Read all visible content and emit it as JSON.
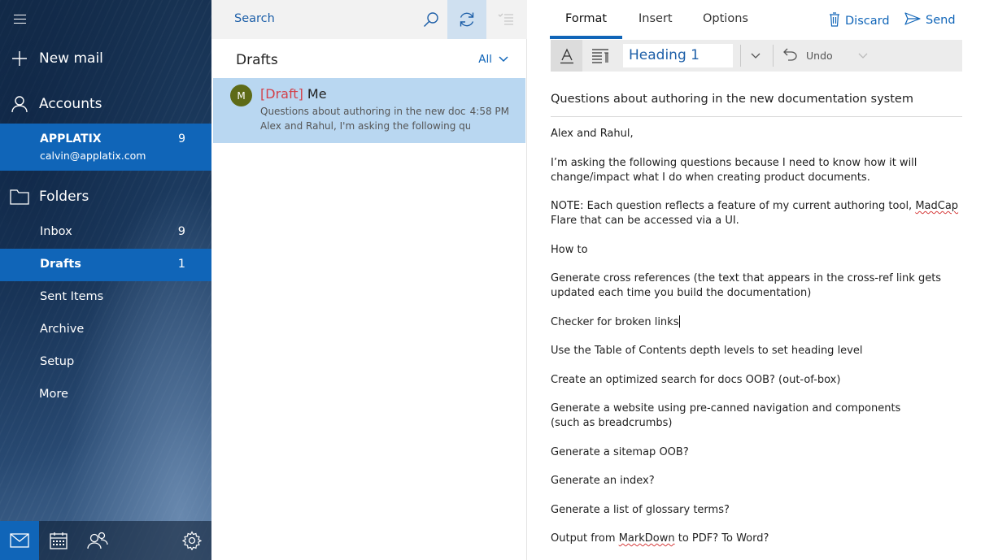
{
  "nav": {
    "new_mail": "New mail",
    "accounts": "Accounts",
    "account": {
      "name": "APPLATIX",
      "email": "calvin@applatix.com",
      "count": "9"
    },
    "folders_label": "Folders",
    "folders": [
      {
        "label": "Inbox",
        "count": "9"
      },
      {
        "label": "Drafts",
        "count": "1"
      },
      {
        "label": "Sent Items",
        "count": ""
      },
      {
        "label": "Archive",
        "count": ""
      },
      {
        "label": "Setup",
        "count": ""
      }
    ],
    "more": "More"
  },
  "list": {
    "search_placeholder": "Search",
    "folder_title": "Drafts",
    "filter": "All",
    "message": {
      "avatar": "M",
      "tag": "[Draft]",
      "from": "Me",
      "subject": "Questions about authoring in the new documentation system",
      "time": "4:58 PM",
      "preview": "Alex and Rahul,    I'm asking the following questions because I need to know"
    }
  },
  "compose": {
    "tabs": [
      "Format",
      "Insert",
      "Options"
    ],
    "discard": "Discard",
    "send": "Send",
    "style": "Heading 1",
    "undo": "Undo",
    "subject": "Questions about authoring in the new documentation system",
    "body": {
      "p1": "Alex and Rahul,",
      "p2": "I’m asking the following questions because I need to know how it will change/impact what I do when creating product documents.",
      "p3a": "NOTE: Each question reflects a feature of my current authoring tool, ",
      "p3b": "MadCap",
      "p3c": " Flare that can be accessed via a UI.",
      "p4": "How to",
      "p5": "Generate cross references (the text that appears in the cross-ref link gets updated each time you build the documentation)",
      "p6": "Checker for broken links",
      "p7": "Use the Table of Contents depth levels to set heading level",
      "p8": "Create an optimized search for docs OOB? (out-of-box)",
      "p9": "Generate a website using pre-canned navigation and components (such as breadcrumbs)",
      "p10": "Generate a sitemap OOB?",
      "p11": "Generate an index?",
      "p12": "Generate a list of glossary terms?",
      "p13a": "Output from ",
      "p13b": "MarkDown",
      "p13c": " to PDF? To Word?"
    }
  },
  "colors": {
    "accent": "#1065b8",
    "selection": "#b9d7f1",
    "draft_tag": "#d3414a",
    "avatar": "#5e6b17"
  },
  "icons": [
    "hamburger-icon",
    "plus-icon",
    "person-icon",
    "folder-icon",
    "mail-icon",
    "calendar-icon",
    "people-icon",
    "gear-icon",
    "search-icon",
    "sync-icon",
    "filter-list-icon",
    "chevron-down-icon",
    "trash-icon",
    "send-icon",
    "font-color-icon",
    "paragraph-format-icon",
    "undo-icon"
  ]
}
